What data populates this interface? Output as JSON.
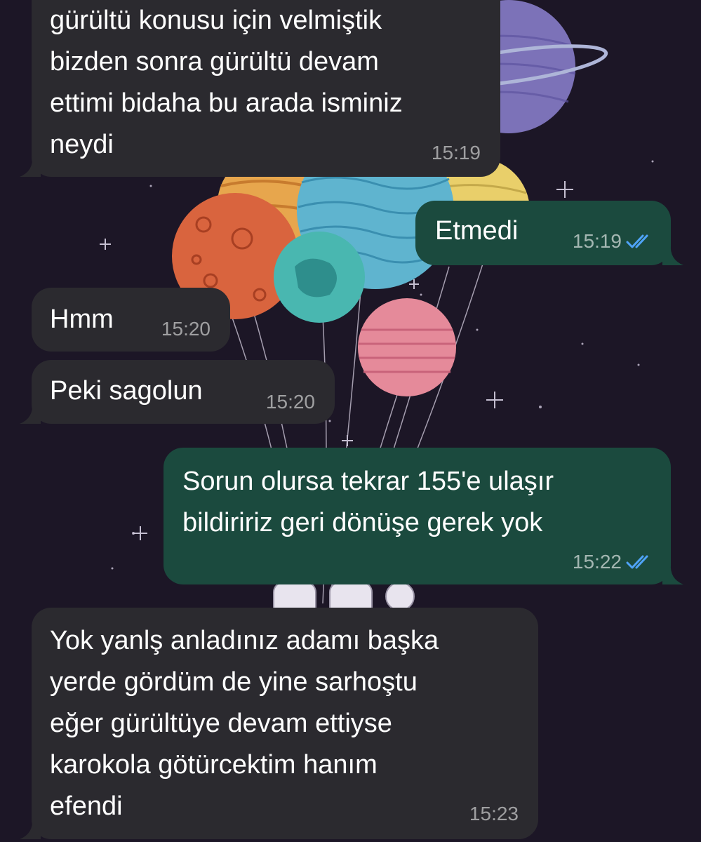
{
  "chat": {
    "messages": [
      {
        "direction": "incoming",
        "text": "gürültü konusu için velmiştik\nbizden sonra gürültü devam\nettimi bidaha bu arada isminiz\nneydi",
        "time": "15:19"
      },
      {
        "direction": "outgoing",
        "text": "Etmedi",
        "time": "15:19",
        "status": "read"
      },
      {
        "direction": "incoming",
        "text": "Hmm",
        "time": "15:20"
      },
      {
        "direction": "incoming",
        "text": "Peki sagolun",
        "time": "15:20"
      },
      {
        "direction": "outgoing",
        "text": "Sorun olursa tekrar 155'e ulaşır\nbildiririz geri dönüşe gerek yok",
        "time": "15:22",
        "status": "read"
      },
      {
        "direction": "incoming",
        "text": "Yok yanlş anladınız adamı başka\nyerde gördüm de yine sarhoştu\neğer gürültüye devam ettiyse\nkarokola götürcektim hanım\nefendi",
        "time": "15:23"
      }
    ]
  },
  "theme": {
    "incoming_bubble": "#2b2a2f",
    "outgoing_bubble": "#1b4a3e",
    "read_ticks": "#4fa3f7",
    "wallpaper_bg": "#1c1626"
  },
  "icons": {
    "read_receipt": "double-check-icon"
  }
}
